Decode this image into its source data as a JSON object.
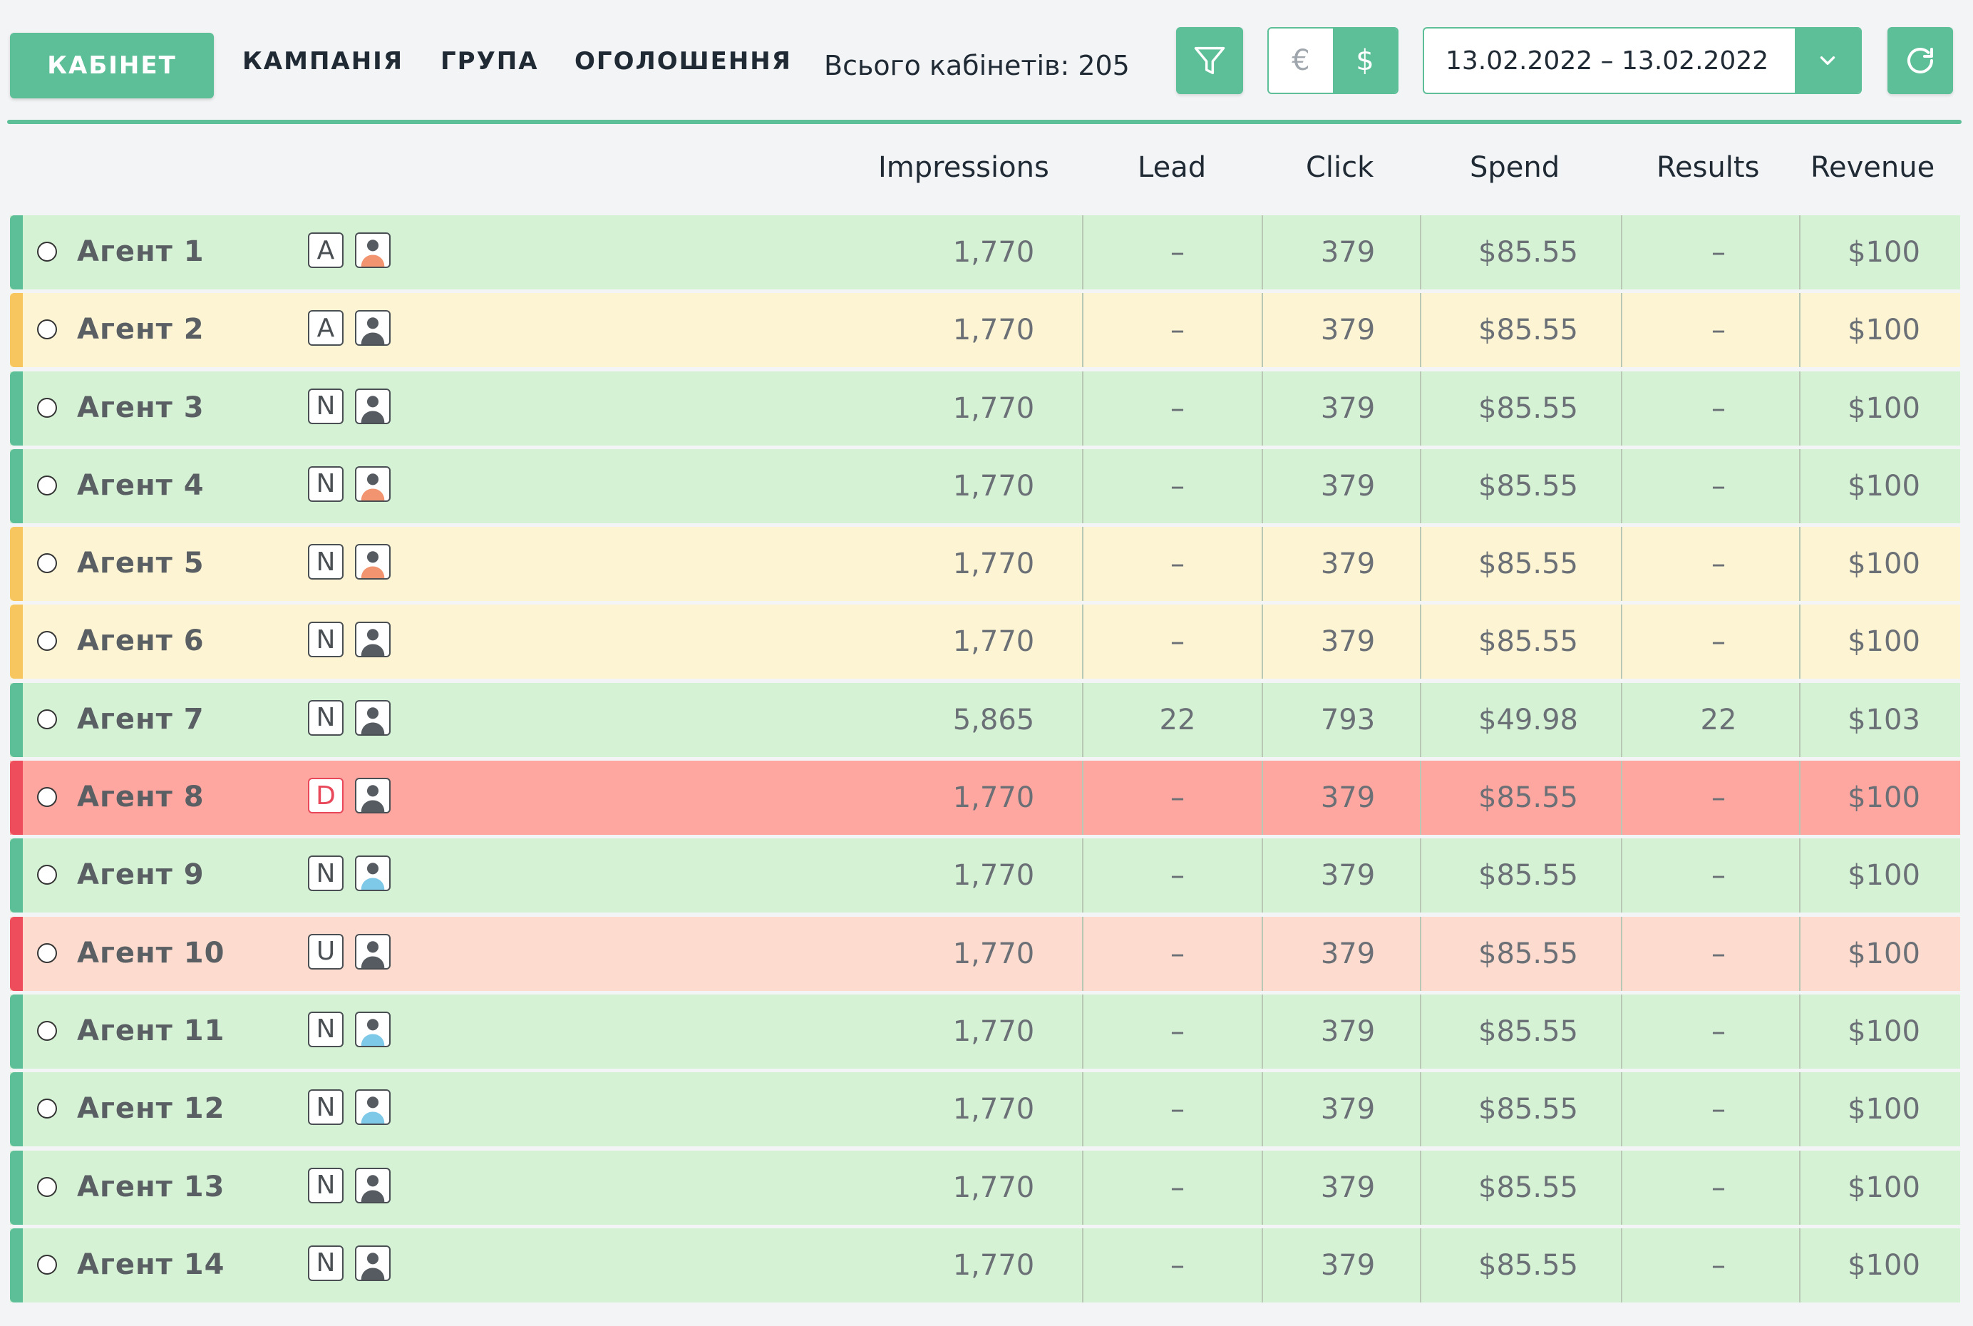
{
  "toolbar": {
    "primary_tab": "КАБІНЕТ",
    "tabs": [
      "КАМПАНІЯ",
      "ГРУПА",
      "ОГОЛОШЕННЯ"
    ],
    "total_label": "Всього кабінетів: 205",
    "filter_icon": "filter-icon",
    "currency": {
      "options": [
        "€",
        "$"
      ],
      "selected": "$"
    },
    "date_range": "13.02.2022 – 13.02.2022",
    "refresh_icon": "refresh-icon"
  },
  "columns": [
    "Impressions",
    "Lead",
    "Click",
    "Spend",
    "Results",
    "Revenue"
  ],
  "colors": {
    "accent": "#5dbf98",
    "row_green": "#d5f2d5",
    "row_yellow": "#fdf4d3",
    "row_red": "#fea7a0",
    "row_peach": "#fddccf",
    "avatar_orange": "#f2946f",
    "avatar_gray": "#555b60",
    "avatar_blue": "#7ec8e8"
  },
  "rows": [
    {
      "name": "Агент 1",
      "badge": "A",
      "avatar": "orange",
      "bg": "green",
      "stripe": "green",
      "impressions": "1,770",
      "lead": "–",
      "click": "379",
      "spend": "$85.55",
      "results": "–",
      "revenue": "$100"
    },
    {
      "name": "Агент 2",
      "badge": "A",
      "avatar": "gray",
      "bg": "yellow",
      "stripe": "yellow",
      "impressions": "1,770",
      "lead": "–",
      "click": "379",
      "spend": "$85.55",
      "results": "–",
      "revenue": "$100"
    },
    {
      "name": "Агент 3",
      "badge": "N",
      "avatar": "gray",
      "bg": "green",
      "stripe": "green",
      "impressions": "1,770",
      "lead": "–",
      "click": "379",
      "spend": "$85.55",
      "results": "–",
      "revenue": "$100"
    },
    {
      "name": "Агент 4",
      "badge": "N",
      "avatar": "orange",
      "bg": "green",
      "stripe": "green",
      "impressions": "1,770",
      "lead": "–",
      "click": "379",
      "spend": "$85.55",
      "results": "–",
      "revenue": "$100"
    },
    {
      "name": "Агент 5",
      "badge": "N",
      "avatar": "orange",
      "bg": "yellow",
      "stripe": "yellow",
      "impressions": "1,770",
      "lead": "–",
      "click": "379",
      "spend": "$85.55",
      "results": "–",
      "revenue": "$100"
    },
    {
      "name": "Агент 6",
      "badge": "N",
      "avatar": "gray",
      "bg": "yellow",
      "stripe": "yellow",
      "impressions": "1,770",
      "lead": "–",
      "click": "379",
      "spend": "$85.55",
      "results": "–",
      "revenue": "$100"
    },
    {
      "name": "Агент 7",
      "badge": "N",
      "avatar": "gray",
      "bg": "green",
      "stripe": "green",
      "impressions": "5,865",
      "lead": "22",
      "click": "793",
      "spend": "$49.98",
      "results": "22",
      "revenue": "$103"
    },
    {
      "name": "Агент 8",
      "badge": "D",
      "avatar": "gray",
      "bg": "red",
      "stripe": "red",
      "impressions": "1,770",
      "lead": "–",
      "click": "379",
      "spend": "$85.55",
      "results": "–",
      "revenue": "$100"
    },
    {
      "name": "Агент 9",
      "badge": "N",
      "avatar": "blue",
      "bg": "green",
      "stripe": "green",
      "impressions": "1,770",
      "lead": "–",
      "click": "379",
      "spend": "$85.55",
      "results": "–",
      "revenue": "$100"
    },
    {
      "name": "Агент 10",
      "badge": "U",
      "avatar": "gray",
      "bg": "peach",
      "stripe": "red",
      "impressions": "1,770",
      "lead": "–",
      "click": "379",
      "spend": "$85.55",
      "results": "–",
      "revenue": "$100"
    },
    {
      "name": "Агент 11",
      "badge": "N",
      "avatar": "blue",
      "bg": "green",
      "stripe": "green",
      "impressions": "1,770",
      "lead": "–",
      "click": "379",
      "spend": "$85.55",
      "results": "–",
      "revenue": "$100"
    },
    {
      "name": "Агент 12",
      "badge": "N",
      "avatar": "blue",
      "bg": "green",
      "stripe": "green",
      "impressions": "1,770",
      "lead": "–",
      "click": "379",
      "spend": "$85.55",
      "results": "–",
      "revenue": "$100"
    },
    {
      "name": "Агент 13",
      "badge": "N",
      "avatar": "gray",
      "bg": "green",
      "stripe": "green",
      "impressions": "1,770",
      "lead": "–",
      "click": "379",
      "spend": "$85.55",
      "results": "–",
      "revenue": "$100"
    },
    {
      "name": "Агент 14",
      "badge": "N",
      "avatar": "gray",
      "bg": "green",
      "stripe": "green",
      "impressions": "1,770",
      "lead": "–",
      "click": "379",
      "spend": "$85.55",
      "results": "–",
      "revenue": "$100"
    }
  ]
}
